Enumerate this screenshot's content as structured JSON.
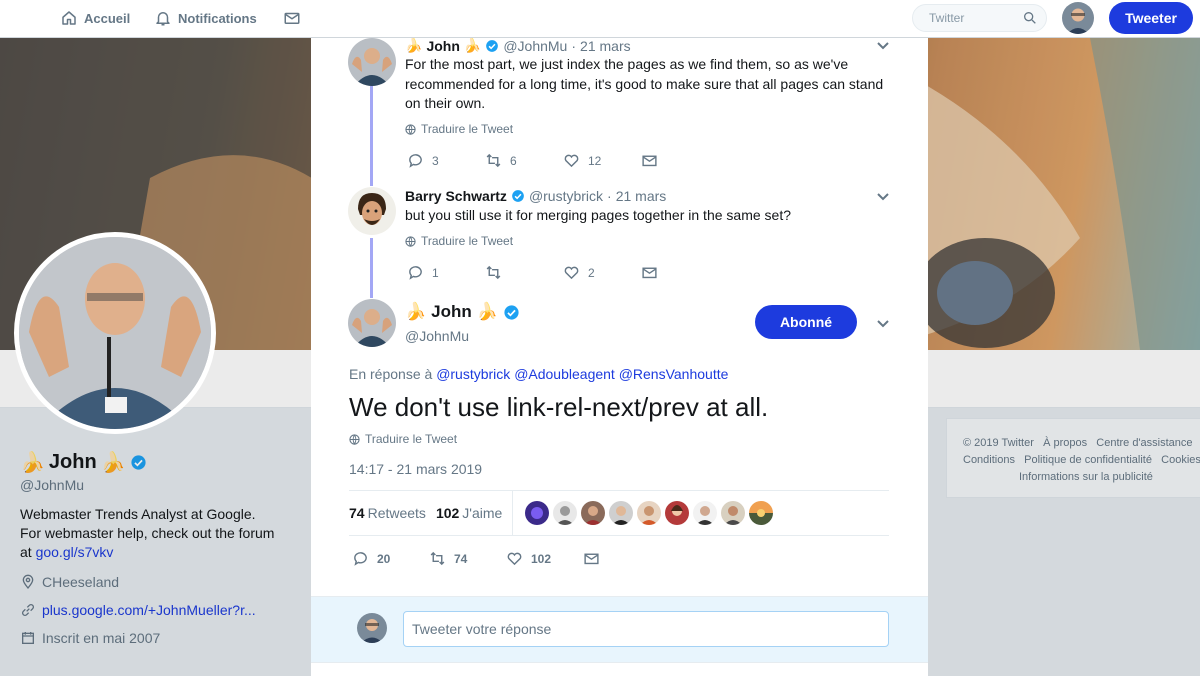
{
  "nav": {
    "home": "Accueil",
    "notifications": "Notifications",
    "search_placeholder": "Twitter",
    "tweet_button": "Tweeter"
  },
  "colors": {
    "accent": "#1d3bde",
    "thread": "#a3a7f5",
    "verified": "#1da1f2"
  },
  "profile": {
    "name": "John",
    "emoji": "🍌",
    "handle": "@JohnMu",
    "bio_text": "Webmaster Trends Analyst at Google. For webmaster help, check out the forum at",
    "bio_link": "goo.gl/s7vkv",
    "location": "CHeeseland",
    "website": "plus.google.com/+JohnMueller?r...",
    "joined": "Inscrit en mai 2007"
  },
  "footer": {
    "line1": [
      "© 2019 Twitter",
      "À propos",
      "Centre d'assistance"
    ],
    "line2": [
      "Conditions",
      "Politique de confidentialité",
      "Cookies"
    ],
    "line3": "Informations sur la publicité"
  },
  "thread": {
    "top_actions": {
      "replies": "1",
      "retweets": "",
      "likes": "2"
    },
    "tweets": [
      {
        "name": "John",
        "emoji": "🍌",
        "handle": "@JohnMu",
        "time": "21 mars",
        "text": "For the most part, we just index the pages as we find them, so as we've recommended for a long time, it's good to make sure that all pages can stand on their own.",
        "translate": "Traduire le Tweet",
        "replies": "3",
        "retweets": "6",
        "likes": "12"
      },
      {
        "name": "Barry Schwartz",
        "handle": "@rustybrick",
        "time": "21 mars",
        "text": "but you still use it for merging pages together in the same set?",
        "translate": "Traduire le Tweet",
        "replies": "1",
        "retweets": "",
        "likes": "2"
      }
    ],
    "main": {
      "name": "John",
      "emoji": "🍌",
      "handle": "@JohnMu",
      "follow_label": "Abonné",
      "reply_prefix": "En réponse à",
      "reply_mentions": [
        "@rustybrick",
        "@Adoubleagent",
        "@RensVanhoutte"
      ],
      "text": "We don't use link-rel-next/prev at all.",
      "translate": "Traduire le Tweet",
      "timestamp": "14:17 - 21 mars 2019",
      "retweets_count": "74",
      "retweets_label": "Retweets",
      "likes_count": "102",
      "likes_label": "J'aime",
      "replies": "20",
      "retweets": "74",
      "likes": "102"
    },
    "reply_placeholder": "Tweeter votre réponse"
  }
}
